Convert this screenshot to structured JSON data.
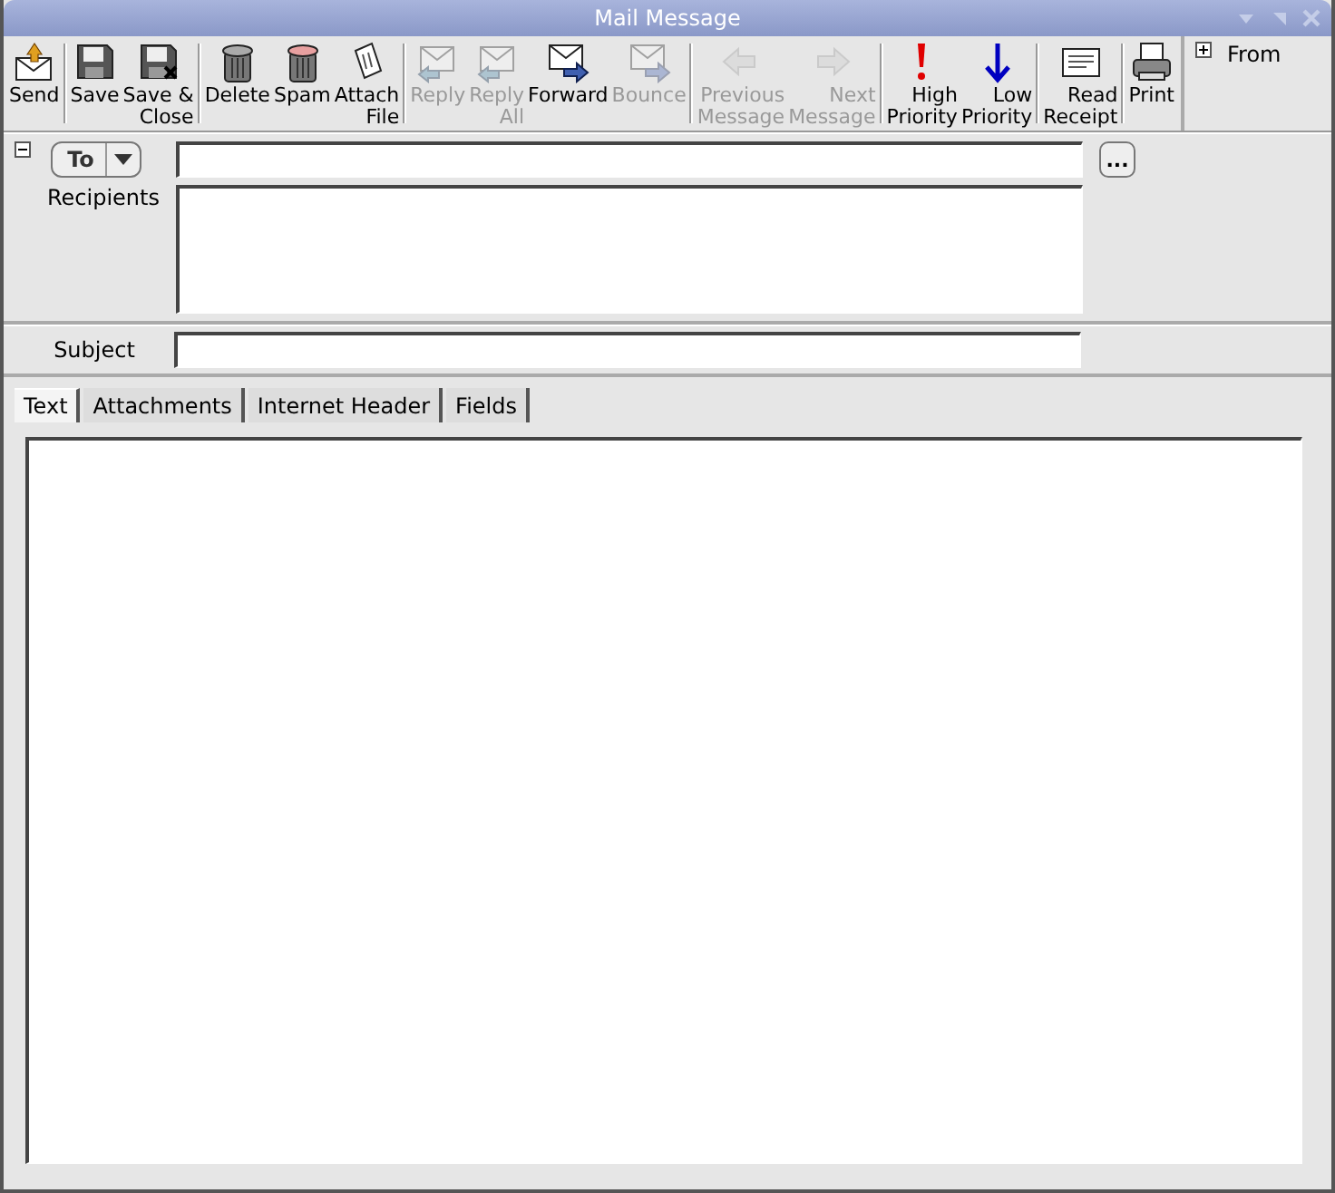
{
  "window": {
    "title": "Mail Message"
  },
  "toolbar": {
    "groups": [
      [
        {
          "label": "Send",
          "kind": "send",
          "disabled": false
        }
      ],
      [
        {
          "label": "Save",
          "kind": "save",
          "disabled": false
        },
        {
          "label": "Save &\nClose",
          "kind": "save-close",
          "disabled": false
        }
      ],
      [
        {
          "label": "Delete",
          "kind": "delete",
          "disabled": false
        },
        {
          "label": "Spam",
          "kind": "spam",
          "disabled": false
        },
        {
          "label": "Attach\nFile",
          "kind": "attach",
          "disabled": false
        }
      ],
      [
        {
          "label": "Reply",
          "kind": "reply",
          "disabled": true
        },
        {
          "label": "Reply\nAll",
          "kind": "reply",
          "disabled": true
        },
        {
          "label": "Forward",
          "kind": "forward",
          "disabled": false
        },
        {
          "label": "Bounce",
          "kind": "forward",
          "disabled": true
        }
      ],
      [
        {
          "label": "Previous\nMessage",
          "kind": "previous",
          "disabled": true
        },
        {
          "label": "Next\nMessage",
          "kind": "next",
          "disabled": true
        }
      ],
      [
        {
          "label": "High\nPriority",
          "kind": "high",
          "disabled": false
        },
        {
          "label": "Low\nPriority",
          "kind": "low",
          "disabled": false
        }
      ],
      [
        {
          "label": "Read\nReceipt",
          "kind": "receipt",
          "disabled": false
        }
      ],
      [
        {
          "label": "Print",
          "kind": "print",
          "disabled": false
        }
      ]
    ]
  },
  "from_panel": {
    "label": "From",
    "expanded": false
  },
  "header": {
    "expanded": true,
    "address_type": "To",
    "recipients_label": "Recipients",
    "browse_button": "...",
    "subject_label": "Subject"
  },
  "tabs": [
    {
      "label": "Text",
      "selected": true
    },
    {
      "label": "Attachments",
      "selected": false
    },
    {
      "label": "Internet Header",
      "selected": false
    },
    {
      "label": "Fields",
      "selected": false
    }
  ]
}
